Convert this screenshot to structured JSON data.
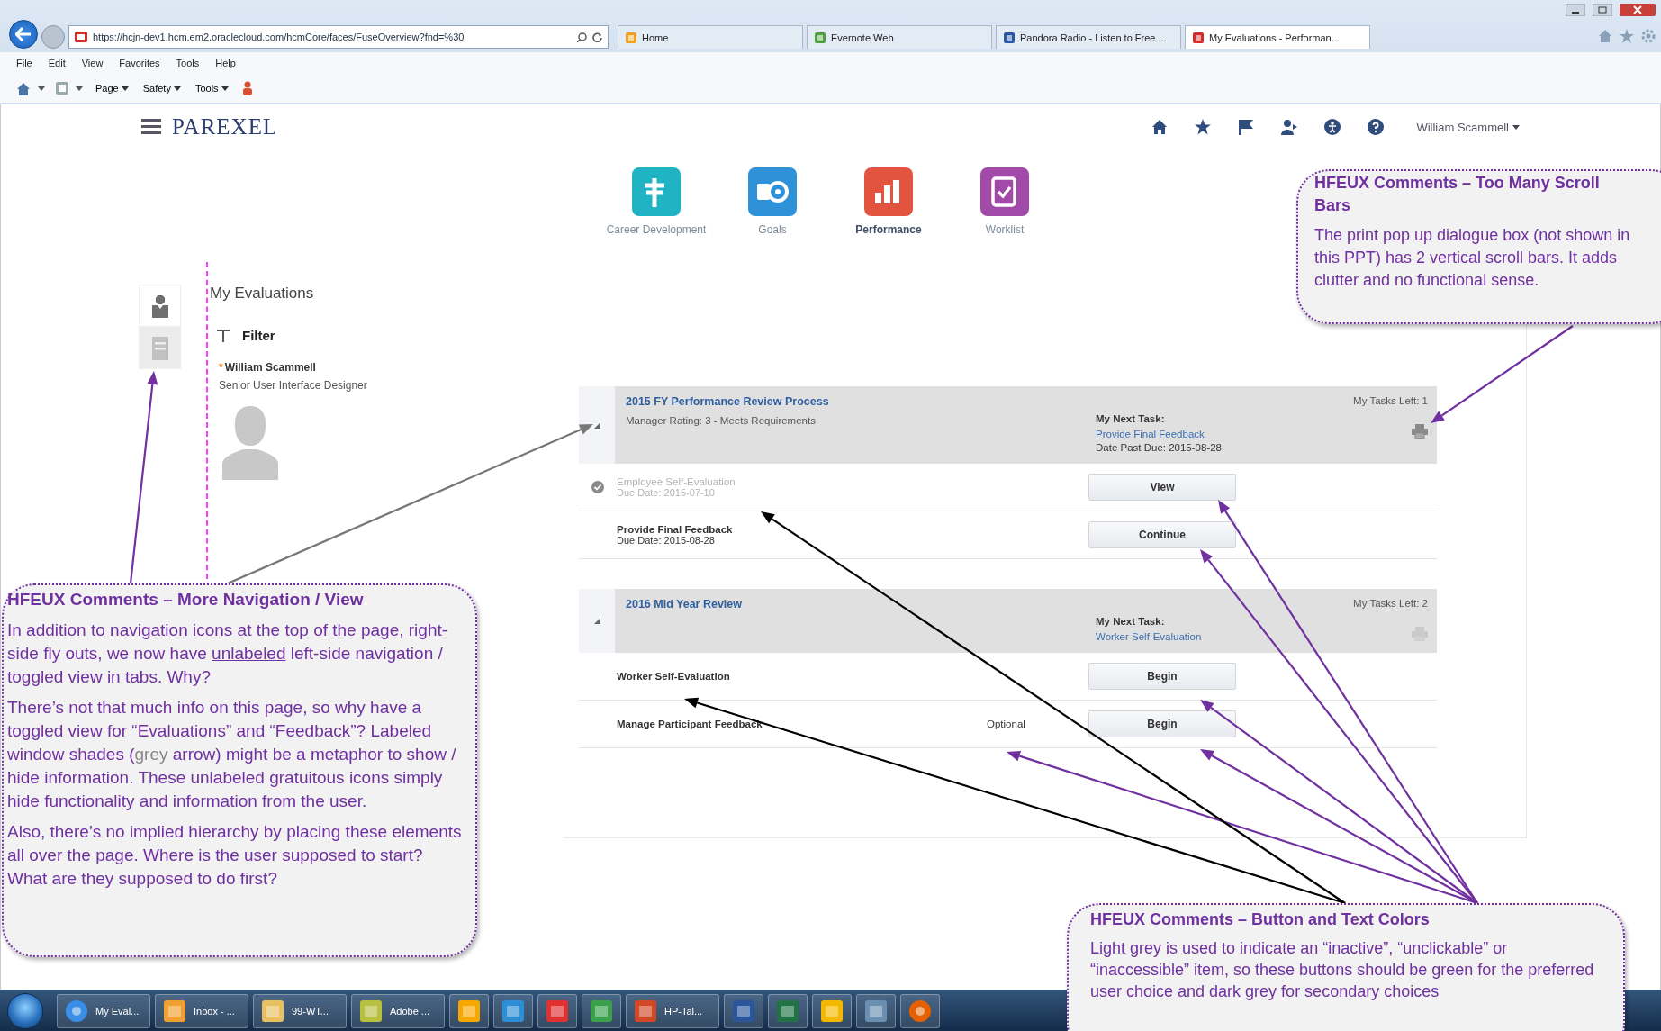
{
  "browser": {
    "address": "https://hcjn-dev1.hcm.em2.oraclecloud.com/hcmCore/faces/FuseOverview?fnd=%30",
    "tabs": [
      {
        "label": "Home",
        "selected": false
      },
      {
        "label": "Evernote Web",
        "selected": false
      },
      {
        "label": "Pandora Radio - Listen to Free ...",
        "selected": false
      },
      {
        "label": "My Evaluations - Performan...",
        "selected": true
      }
    ],
    "menu": [
      "File",
      "Edit",
      "View",
      "Favorites",
      "Tools",
      "Help"
    ],
    "commands": [
      "Page",
      "Safety",
      "Tools"
    ]
  },
  "app": {
    "logo": "PAREXEL",
    "user": "William Scammell",
    "nav": [
      {
        "kind": "career",
        "label": "Career Development",
        "color": "#1fb3c4",
        "selected": false
      },
      {
        "kind": "goals",
        "label": "Goals",
        "color": "#2f92d8",
        "selected": false
      },
      {
        "kind": "performance",
        "label": "Performance",
        "color": "#e2543f",
        "selected": true
      },
      {
        "kind": "worklist",
        "label": "Worklist",
        "color": "#a24aa8",
        "selected": false
      }
    ]
  },
  "side_tabs": [
    {
      "kind": "person",
      "selected": true
    },
    {
      "kind": "list",
      "selected": false
    }
  ],
  "page": {
    "title": "My Evaluations",
    "filter": "Filter",
    "person": {
      "marker": "*",
      "name": "William Scammell",
      "role": "Senior User Interface Designer"
    }
  },
  "evaluations": [
    {
      "title": "2015 FY Performance Review Process",
      "rating": "Manager Rating: 3 - Meets Requirements",
      "tasks_left": "My Tasks Left: 1",
      "next_task_label": "My Next Task:",
      "next_task": "Provide Final Feedback",
      "due": "Date Past Due: 2015-08-28",
      "print_enabled": true,
      "tasks": [
        {
          "name": "Employee Self-Evaluation",
          "due": "Due Date: 2015-07-10",
          "action": "View",
          "done": true
        },
        {
          "name": "Provide Final Feedback",
          "due": "Due Date: 2015-08-28",
          "action": "Continue",
          "done": false
        }
      ]
    },
    {
      "title": "2016 Mid Year Review",
      "tasks_left": "My Tasks Left: 2",
      "next_task_label": "My Next Task:",
      "next_task": "Worker Self-Evaluation",
      "print_enabled": false,
      "tasks": [
        {
          "name": "Worker Self-Evaluation",
          "action": "Begin",
          "done": false
        },
        {
          "name": "Manage Participant Feedback",
          "note": "Optional",
          "action": "Begin",
          "done": false
        }
      ]
    }
  ],
  "callouts": [
    {
      "title": "HFEUX Comments – More Navigation / View",
      "paragraphs": [
        [
          {
            "text": "In addition to navigation icons at the top of the page, right-side fly outs, we now have ",
            "kind": "plain"
          },
          {
            "text": "unlabeled",
            "kind": "underline"
          },
          {
            "text": " left-side navigation / toggled view in tabs. Why?",
            "kind": "plain"
          }
        ],
        [
          {
            "text": "There’s not that much info on this page, so why have a toggled view for “Evaluations” and “Feedback”? Labeled window shades (",
            "kind": "plain"
          },
          {
            "text": "grey",
            "kind": "grey"
          },
          {
            "text": " arrow) might be a metaphor to show / hide information. These unlabeled gratuitous icons simply hide functionality and information from the user.",
            "kind": "plain"
          }
        ],
        [
          {
            "text": "Also, there’s no implied hierarchy by placing these elements all over the page. Where is the user supposed to start? What are they supposed to do first?",
            "kind": "plain"
          }
        ]
      ]
    },
    {
      "title": "HFEUX Comments – Too Many Scroll Bars",
      "paragraphs": [
        [
          {
            "text": "The print pop up dialogue box (not shown in this PPT) has 2 vertical scroll bars. It adds clutter and no functional sense.",
            "kind": "plain"
          }
        ]
      ]
    },
    {
      "title": "HFEUX Comments – Button and Text Colors",
      "paragraphs": [
        [
          {
            "text": "Light grey is used to indicate an “inactive”, “unclickable” or “inaccessible” item, so these buttons should be green for the preferred user choice and dark grey for secondary choices",
            "kind": "plain"
          }
        ]
      ]
    }
  ],
  "taskbar": [
    {
      "kind": "browser",
      "label": "My Eval..."
    },
    {
      "kind": "mail",
      "label": "Inbox - ..."
    },
    {
      "kind": "folder",
      "label": "99-WT..."
    },
    {
      "kind": "editor",
      "label": "Adobe ..."
    },
    {
      "kind": "illustrator"
    },
    {
      "kind": "photoshop"
    },
    {
      "kind": "pdf"
    },
    {
      "kind": "recorder"
    },
    {
      "kind": "slides",
      "label": "HP-Tal..."
    },
    {
      "kind": "word"
    },
    {
      "kind": "sheet"
    },
    {
      "kind": "chat"
    },
    {
      "kind": "monitor"
    },
    {
      "kind": "firefox"
    }
  ]
}
